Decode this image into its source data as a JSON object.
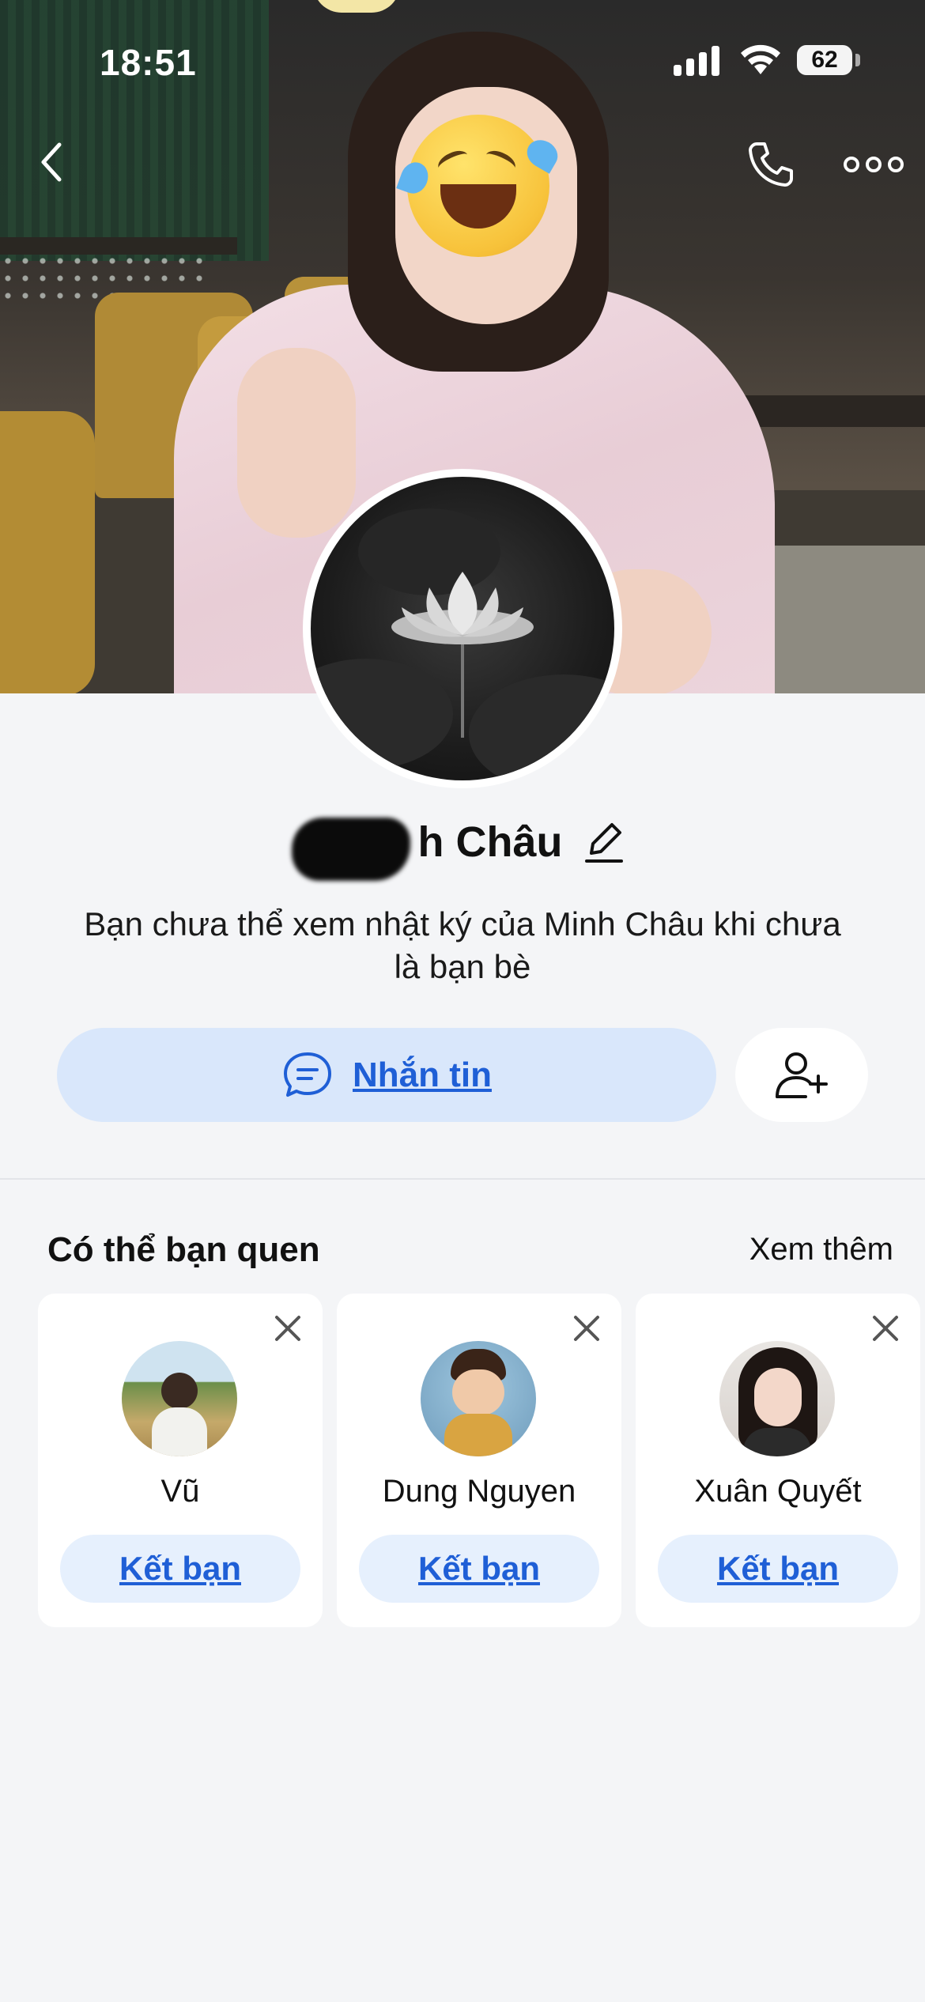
{
  "status_bar": {
    "time": "18:51",
    "battery_level": "62",
    "battery_fraction": 0.62,
    "signal_bars": 4,
    "icons": [
      "signal-icon",
      "wifi-icon",
      "battery-icon"
    ]
  },
  "nav": {
    "back_icon": "chevron-left-icon",
    "call_icon": "phone-icon",
    "more_icon": "more-horizontal-icon"
  },
  "profile": {
    "name": "Minh Châu",
    "visible_name_suffix": "h Châu",
    "edit_icon": "pencil-icon",
    "privacy_note": "Bạn chưa thể xem nhật ký của Minh Châu khi chưa là bạn bè"
  },
  "actions": {
    "message_label": "Nhắn tin",
    "message_icon": "chat-bubble-icon",
    "add_friend_icon": "user-plus-icon"
  },
  "suggestions": {
    "title": "Có thể bạn quen",
    "see_more": "Xem thêm",
    "items": [
      {
        "name": "Vũ",
        "button_label": "Kết bạn"
      },
      {
        "name": "Dung Nguyen",
        "button_label": "Kết bạn"
      },
      {
        "name": "Xuân Quyết",
        "button_label": "Kết bạn"
      }
    ]
  },
  "colors": {
    "accent": "#1f5fd6",
    "message_button_bg": "#d9e7fb",
    "card_button_bg": "#e6f0fd",
    "page_bg": "#f4f5f7"
  }
}
